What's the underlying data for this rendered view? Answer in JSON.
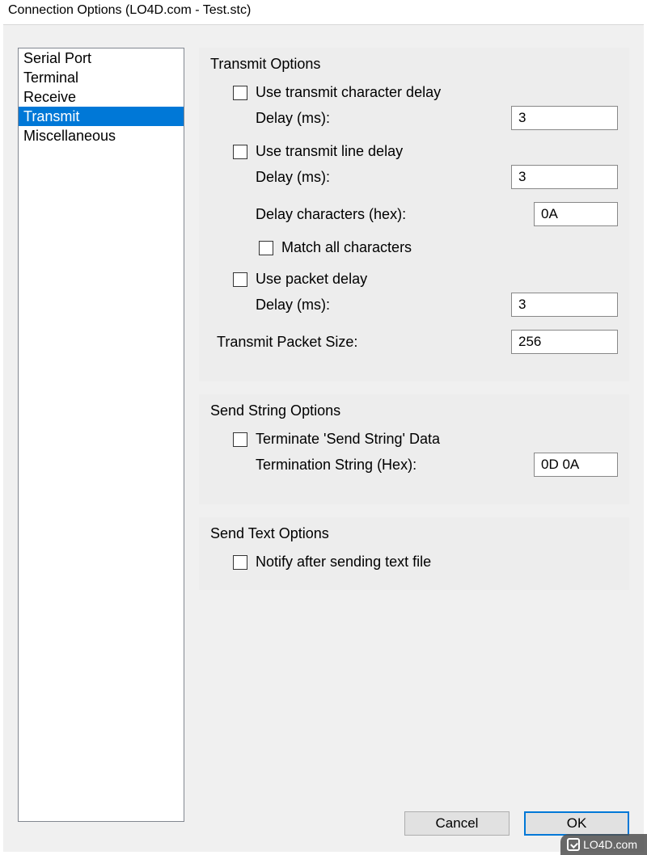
{
  "title": "Connection Options (LO4D.com - Test.stc)",
  "sidebar": {
    "items": [
      {
        "label": "Serial Port",
        "selected": false
      },
      {
        "label": "Terminal",
        "selected": false
      },
      {
        "label": "Receive",
        "selected": false
      },
      {
        "label": "Transmit",
        "selected": true
      },
      {
        "label": "Miscellaneous",
        "selected": false
      }
    ]
  },
  "transmit": {
    "title": "Transmit Options",
    "char_delay": {
      "label": "Use transmit character delay",
      "checked": false
    },
    "char_delay_ms": {
      "label": "Delay (ms):",
      "value": "3"
    },
    "line_delay": {
      "label": "Use transmit line delay",
      "checked": false
    },
    "line_delay_ms": {
      "label": "Delay (ms):",
      "value": "3"
    },
    "delay_chars": {
      "label": "Delay characters (hex):",
      "value": "0A"
    },
    "match_all": {
      "label": "Match all characters",
      "checked": false
    },
    "packet_delay": {
      "label": "Use packet delay",
      "checked": false
    },
    "packet_delay_ms": {
      "label": "Delay (ms):",
      "value": "3"
    },
    "packet_size": {
      "label": "Transmit Packet Size:",
      "value": "256"
    }
  },
  "sendstring": {
    "title": "Send String Options",
    "terminate": {
      "label": "Terminate 'Send String' Data",
      "checked": false
    },
    "term_string": {
      "label": "Termination String (Hex):",
      "value": "0D 0A"
    }
  },
  "sendtext": {
    "title": "Send Text Options",
    "notify": {
      "label": "Notify after sending text file",
      "checked": false
    }
  },
  "buttons": {
    "cancel": "Cancel",
    "ok": "OK"
  },
  "watermark": "LO4D.com"
}
